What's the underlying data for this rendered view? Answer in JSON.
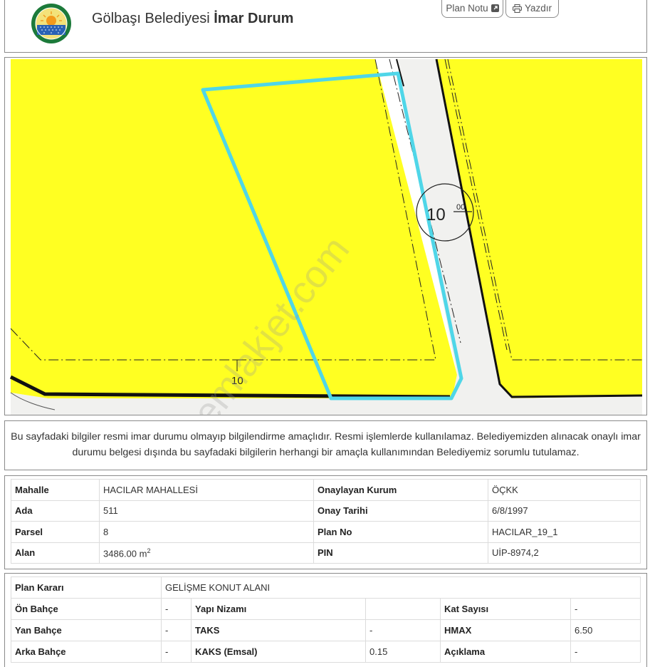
{
  "header": {
    "title_prefix": "Gölbaşı Belediyesi",
    "title_bold": "İmar Durum",
    "buttons": {
      "plan_notu": "Plan Notu",
      "yazdir": "Yazdır"
    },
    "logo_icon": "golbasi-municipality-seal-icon",
    "plan_notu_icon": "external-link-icon",
    "yazdir_icon": "printer-icon"
  },
  "map": {
    "road_label": "10",
    "road_label_sub": "00",
    "bottom_label": "10",
    "watermark": "emlakjet.com",
    "colors": {
      "zone": "#ffff22",
      "road": "#f2f2f2",
      "parcel_outline": "#4fd6e8",
      "boundary": "#111111"
    }
  },
  "notice": "Bu sayfadaki bilgiler resmi imar durumu olmayıp bilgilendirme amaçlıdır. Resmi işlemlerde kullanılamaz. Belediyemizden alınacak onaylı imar durumu belgesi dışında bu sayfadaki bilgilerin herhangi bir amaçla kullanımından Belediyemiz sorumlu tutulamaz.",
  "info": {
    "mahalle_label": "Mahalle",
    "mahalle": "HACILAR MAHALLESİ",
    "onaylayan_label": "Onaylayan Kurum",
    "onaylayan": "ÖÇKK",
    "ada_label": "Ada",
    "ada": "511",
    "onay_tarihi_label": "Onay Tarihi",
    "onay_tarihi": "6/8/1997",
    "parsel_label": "Parsel",
    "parsel": "8",
    "plan_no_label": "Plan No",
    "plan_no": "HACILAR_19_1",
    "alan_label": "Alan",
    "alan": "3486.00 m",
    "alan_unit_sup": "2",
    "pin_label": "PIN",
    "pin": "UİP-8974,2"
  },
  "plan": {
    "plan_karari_label": "Plan Kararı",
    "plan_karari": "GELİŞME KONUT ALANI",
    "on_bahce_label": "Ön Bahçe",
    "on_bahce": "-",
    "yapi_nizami_label": "Yapı Nizamı",
    "yapi_nizami": "",
    "kat_sayisi_label": "Kat Sayısı",
    "kat_sayisi": "-",
    "yan_bahce_label": "Yan Bahçe",
    "yan_bahce": "-",
    "taks_label": "TAKS",
    "taks": "-",
    "hmax_label": "HMAX",
    "hmax": "6.50",
    "arka_bahce_label": "Arka Bahçe",
    "arka_bahce": "-",
    "kaks_label": "KAKS (Emsal)",
    "kaks": "0.15",
    "aciklama_label": "Açıklama",
    "aciklama": "-"
  }
}
